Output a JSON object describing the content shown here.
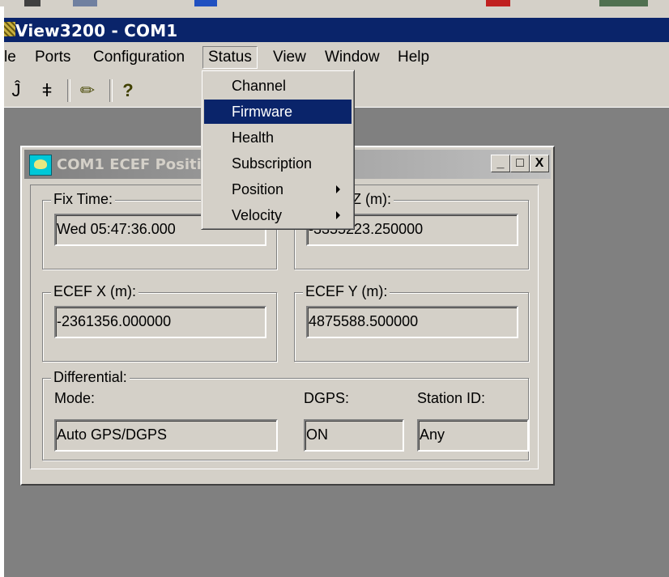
{
  "app": {
    "title": "View3200 - COM1"
  },
  "menubar": {
    "items": [
      "le",
      "Ports",
      "Configuration",
      "Status",
      "View",
      "Window",
      "Help"
    ]
  },
  "toolbar": {
    "icons": [
      "connect-icon",
      "disconnect-icon",
      "eraser-icon",
      "help-icon"
    ],
    "glyphs": [
      "Ĵ",
      "ǂ",
      "✏",
      "?"
    ]
  },
  "status_menu": {
    "items": [
      {
        "label": "Channel"
      },
      {
        "label": "Firmware"
      },
      {
        "label": "Health"
      },
      {
        "label": "Subscription"
      },
      {
        "label": "Position"
      },
      {
        "label": "Velocity"
      }
    ]
  },
  "child_window": {
    "title": "COM1 ECEF Positi",
    "buttons": [
      "_",
      "□",
      "X"
    ],
    "fix_time": {
      "label": "Fix Time:",
      "value": "Wed 05:47:36.000"
    },
    "ecef_z": {
      "label": "Z (m):",
      "value": "-3355223.250000"
    },
    "ecef_x": {
      "label": "ECEF X (m):",
      "value": "-2361356.000000"
    },
    "ecef_y": {
      "label": "ECEF Y (m):",
      "value": "4875588.500000"
    },
    "differential": {
      "label": "Differential:",
      "mode_label": "Mode:",
      "mode_value": "Auto GPS/DGPS",
      "dgps_label": "DGPS:",
      "dgps_value": "ON",
      "station_label": "Station ID:",
      "station_value": "Any"
    }
  },
  "colors": {
    "titlebar": "#0a246a",
    "face": "#d4d0c8",
    "mdi_background": "#808080",
    "highlight": "#0a246a"
  }
}
